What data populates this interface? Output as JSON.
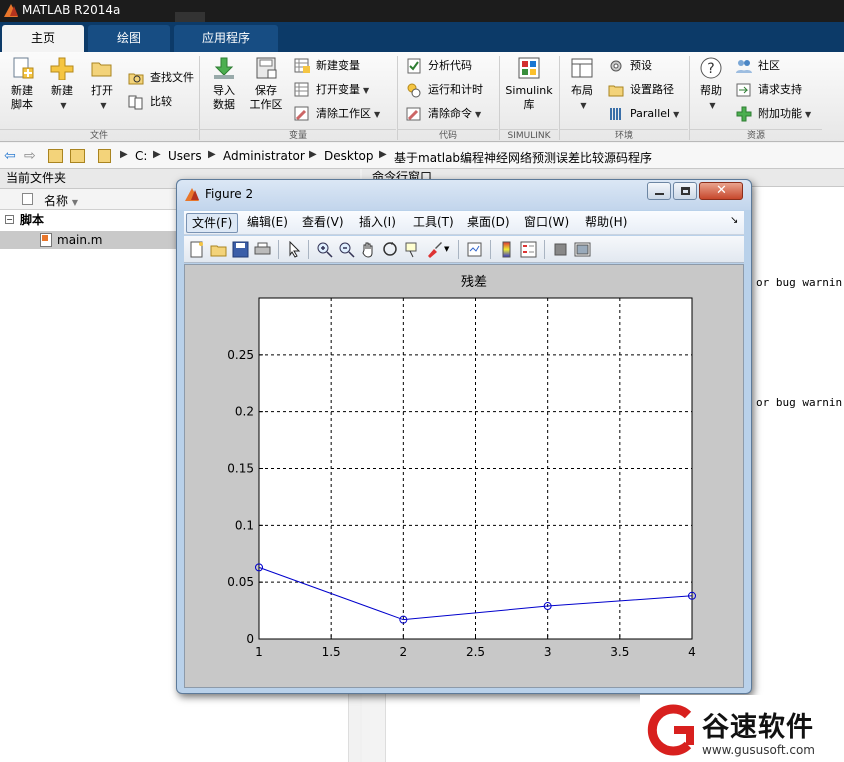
{
  "window": {
    "title": "MATLAB R2014a"
  },
  "ribbon": {
    "tabs": [
      {
        "label": "主页",
        "active": true
      },
      {
        "label": "绘图",
        "active": false
      },
      {
        "label": "应用程序",
        "active": false
      }
    ],
    "file_group": {
      "new_script": "新建\n脚本",
      "new": "新建",
      "open": "打开",
      "find_files": "查找文件",
      "compare": "比较",
      "label": "文件"
    },
    "variable_group": {
      "import_data": "导入\n数据",
      "save_workspace": "保存\n工作区",
      "new_variable": "新建变量",
      "open_variable": "打开变量",
      "clear_workspace": "清除工作区",
      "label": "变量"
    },
    "code_group": {
      "analyze_code": "分析代码",
      "run_and_time": "运行和计时",
      "clear_commands": "清除命令",
      "label": "代码"
    },
    "simulink_group": {
      "library": "Simulink\n库",
      "label": "SIMULINK"
    },
    "environment_group": {
      "layout": "布局",
      "preferences": "预设",
      "set_path": "设置路径",
      "parallel": "Parallel",
      "label": "环境"
    },
    "resources_group": {
      "help": "帮助",
      "community": "社区",
      "request_support": "请求支持",
      "add_ons": "附加功能",
      "label": "资源"
    }
  },
  "address_bar": {
    "segments": [
      "C:",
      "Users",
      "Administrator",
      "Desktop",
      "基于matlab编程神经网络预测误差比较源码程序"
    ]
  },
  "current_folder": {
    "title": "当前文件夹",
    "column_name": "名称",
    "items": [
      {
        "label": "脚本",
        "type": "group"
      },
      {
        "label": "main.m",
        "type": "file"
      }
    ]
  },
  "command_window": {
    "title": "命令行窗口",
    "lines": [
      "or bug warnin",
      "or bug warnin"
    ]
  },
  "figure": {
    "title": "Figure 2",
    "menus": [
      "文件(F)",
      "编辑(E)",
      "查看(V)",
      "插入(I)",
      "工具(T)",
      "桌面(D)",
      "窗口(W)",
      "帮助(H)"
    ]
  },
  "chart_data": {
    "type": "line",
    "title": "残差",
    "xlabel": "",
    "ylabel": "",
    "x": [
      1,
      2,
      3,
      4
    ],
    "series": [
      {
        "values": [
          0.063,
          0.017,
          0.029,
          0.038
        ],
        "color": "#0000cc",
        "marker": "circle"
      }
    ],
    "xlim": [
      1,
      4
    ],
    "ylim": [
      0,
      0.3
    ],
    "xticks": [
      1,
      1.5,
      2,
      2.5,
      3,
      3.5,
      4
    ],
    "yticks": [
      0,
      0.05,
      0.1,
      0.15,
      0.2,
      0.25
    ],
    "grid": true
  },
  "watermark": {
    "text": "谷速软件",
    "url": "www.gususoft.com"
  },
  "colors": {
    "accent": "#0c3a68",
    "line": "#0000cc",
    "brand": "#d8201e"
  }
}
